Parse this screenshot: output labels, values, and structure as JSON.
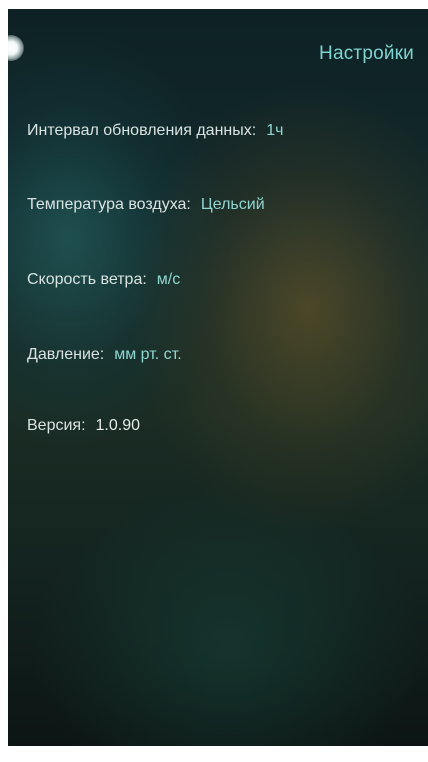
{
  "header": {
    "title": "Настройки"
  },
  "settings": {
    "interval": {
      "label": "Интервал обновления данных:",
      "value": "1ч"
    },
    "temperature": {
      "label": "Температура воздуха:",
      "value": "Цельсий"
    },
    "wind": {
      "label": "Скорость ветра:",
      "value": "м/с"
    },
    "pressure": {
      "label": "Давление:",
      "value": "мм рт. ст."
    },
    "version": {
      "label": "Версия:",
      "value": "1.0.90"
    }
  },
  "colors": {
    "accent": "#7fd3cf",
    "label_text": "#d9e3e1",
    "background_dark": "#0e2225"
  }
}
